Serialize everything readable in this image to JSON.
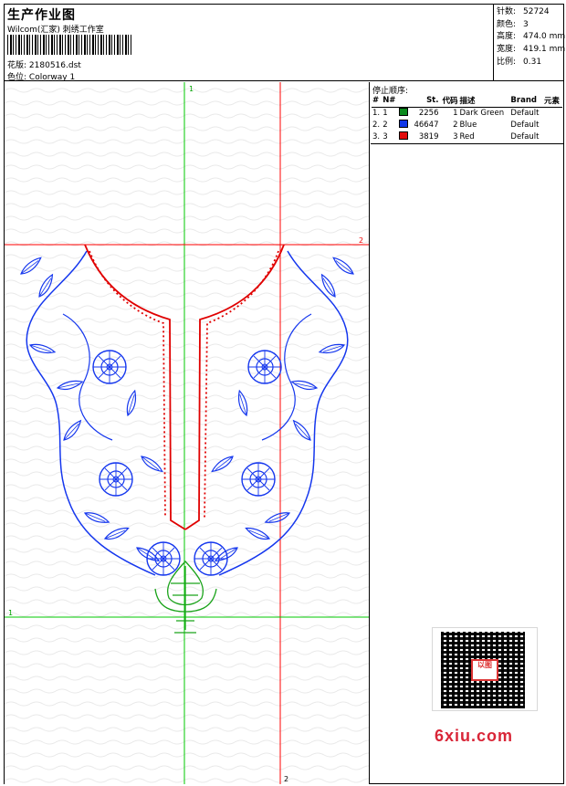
{
  "header": {
    "title": "生产作业图",
    "studio": "Wilcom(汇家) 刺绣工作室",
    "pattern_label": "花版:",
    "pattern_value": "2180516.dst",
    "colorway_label": "色位:",
    "colorway_value": "Colorway 1"
  },
  "stats": [
    {
      "label": "针数:",
      "value": "52724"
    },
    {
      "label": "颜色:",
      "value": "3"
    },
    {
      "label": "高度:",
      "value": "474.0 mm"
    },
    {
      "label": "宽度:",
      "value": "419.1 mm"
    },
    {
      "label": "比例:",
      "value": "0.31"
    }
  ],
  "stop_sequence": {
    "title": "停止顺序:",
    "columns": [
      "#",
      "N#",
      "St.",
      "代码",
      "描述",
      "Brand",
      "元素"
    ],
    "rows": [
      {
        "index": "1.",
        "n": "1",
        "color": "#0b8a1d",
        "stitches": "2256",
        "code": "1",
        "description": "Dark Green",
        "brand": "Default"
      },
      {
        "index": "2.",
        "n": "2",
        "color": "#1037e8",
        "stitches": "46647",
        "code": "2",
        "description": "Blue",
        "brand": "Default"
      },
      {
        "index": "3.",
        "n": "3",
        "color": "#e20b0b",
        "stitches": "3819",
        "code": "3",
        "description": "Red",
        "brand": "Default"
      }
    ]
  },
  "guides": {
    "v1": "1",
    "v2": "2",
    "h1": "1",
    "h2": "2"
  },
  "watermark": "6xiu.com",
  "qr_stamp": "以图"
}
